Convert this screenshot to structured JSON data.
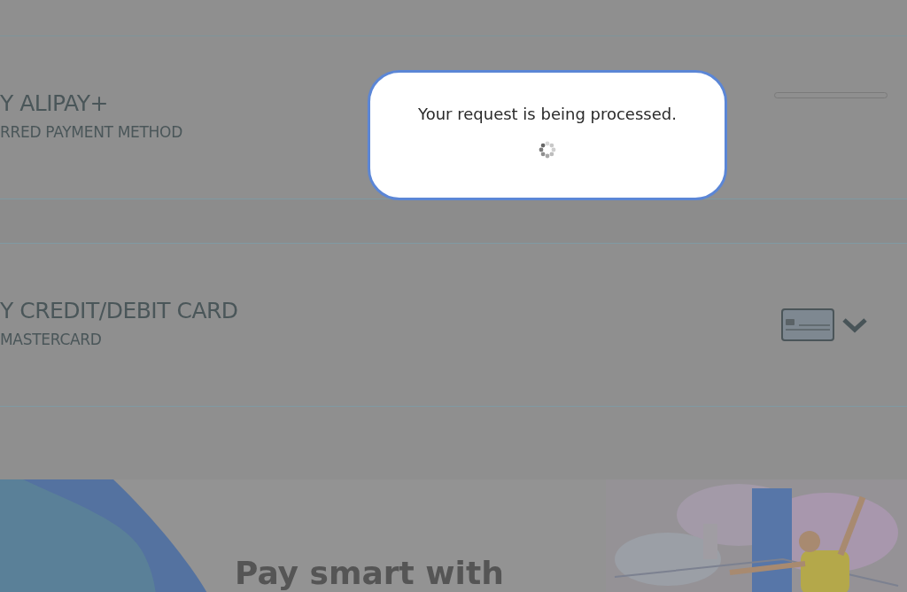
{
  "payment_options": [
    {
      "kind": "alipay",
      "title": "Y ALIPAY+",
      "subtitle": "RRED PAYMENT METHOD"
    },
    {
      "kind": "card",
      "title": "Y CREDIT/DEBIT CARD",
      "subtitle": "MASTERCARD"
    }
  ],
  "banner": {
    "headline": "Pay smart with"
  },
  "modal": {
    "message": "Your request is being processed."
  }
}
